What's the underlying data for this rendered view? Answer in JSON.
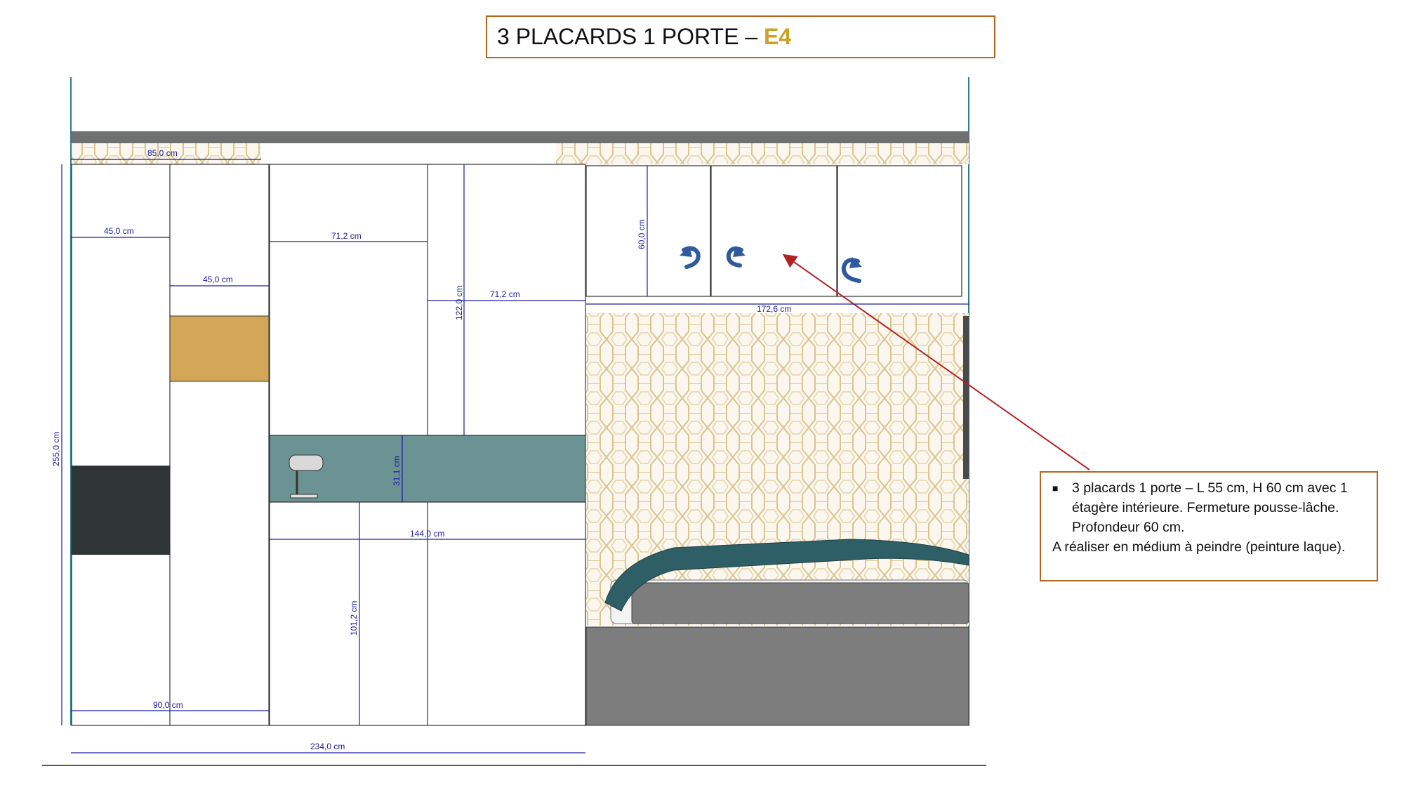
{
  "title": {
    "main": "3 PLACARDS 1 PORTE –",
    "code": "E4"
  },
  "note": {
    "bullet": "3 placards 1 porte – L 55 cm, H 60 cm avec 1 étagère intérieure. Fermeture pousse-lâche. Profondeur 60 cm.",
    "body": "A réaliser en médium à peindre (peinture laque)."
  },
  "dimensions": {
    "d85": "85,0 cm",
    "d45a": "45,0 cm",
    "d45b": "45,0 cm",
    "d712a": "71,2 cm",
    "d712b": "71,2 cm",
    "d600": "60,0 cm",
    "d1226": "172,6 cm",
    "d1220": "122,0 cm",
    "d311": "31,1 cm",
    "d1440": "144,0 cm",
    "d1012": "101,2 cm",
    "d900": "90,0 cm",
    "d2550": "255,0 cm",
    "d2340": "234,0 cm"
  },
  "colors": {
    "accent_gold": "#c9a227",
    "border_brown": "#b5651d",
    "dimension_blue": "#1a1aa0",
    "pointer_red": "#b22222",
    "niche_teal": "#6b9393",
    "panel_gold": "#d4a657",
    "panel_dark": "#2e3534",
    "bed_gray": "#7d7d7d",
    "door_arrow_blue": "#2f5a9e"
  },
  "icons": [
    "door-open-arrow-icon",
    "lamp-icon"
  ]
}
